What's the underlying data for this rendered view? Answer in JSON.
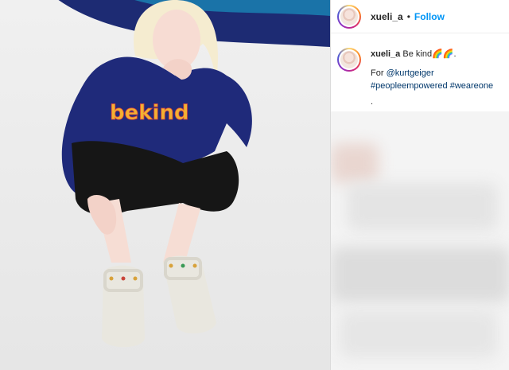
{
  "post": {
    "username": "xueli_a",
    "separator": "•",
    "follow_label": "Follow"
  },
  "caption": {
    "username": "xueli_a",
    "text": "Be kind🌈🌈.",
    "line2_prefix": "For",
    "mention": "@kurtgeiger",
    "hashtags": [
      "#peopleempowered",
      "#weareone"
    ],
    "trailing": "."
  },
  "photo": {
    "sweater_text": "bekind",
    "rainbow_colors": [
      "#1d2b73",
      "#1a73a8",
      "#1aa7b2",
      "#5cc39a",
      "#f3d23a"
    ]
  }
}
